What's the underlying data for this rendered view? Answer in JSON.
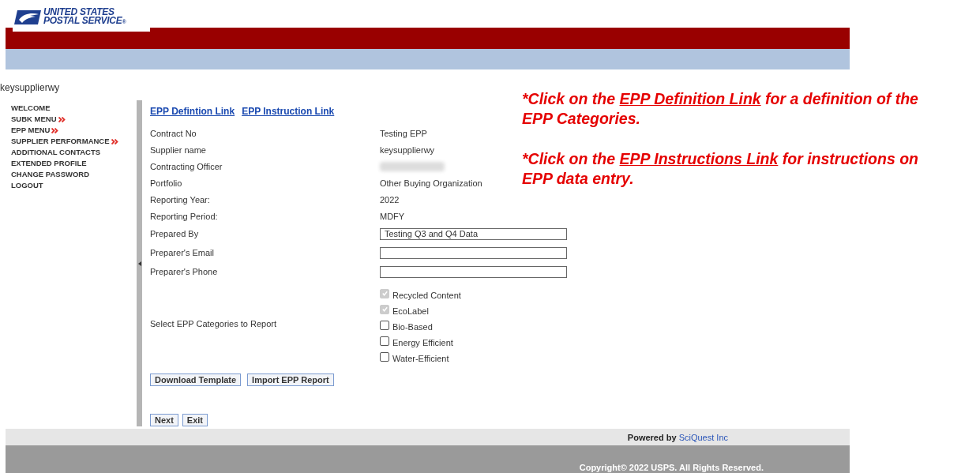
{
  "logo": {
    "line1": "UNITED STATES",
    "line2": "POSTAL SERVICE",
    "mark": "®"
  },
  "user": "keysupplierwy",
  "nav": [
    {
      "label": "WELCOME",
      "submenu": false
    },
    {
      "label": "SUBK MENU",
      "submenu": true
    },
    {
      "label": "EPP MENU",
      "submenu": true
    },
    {
      "label": "SUPPLIER PERFORMANCE",
      "submenu": true
    },
    {
      "label": "ADDITIONAL CONTACTS",
      "submenu": false
    },
    {
      "label": "EXTENDED PROFILE",
      "submenu": false
    },
    {
      "label": "CHANGE PASSWORD",
      "submenu": false
    },
    {
      "label": "LOGOUT",
      "submenu": false
    }
  ],
  "links": [
    "EPP Defintion Link",
    "EPP Instruction Link"
  ],
  "fields": [
    {
      "kind": "text",
      "label": "Contract No",
      "value": "Testing EPP"
    },
    {
      "kind": "text",
      "label": "Supplier name",
      "value": "keysupplierwy"
    },
    {
      "kind": "redacted",
      "label": "Contracting Officer"
    },
    {
      "kind": "text",
      "label": "Portfolio",
      "value": "Other Buying Organization"
    },
    {
      "kind": "text",
      "label": "Reporting Year:",
      "value": "2022"
    },
    {
      "kind": "text",
      "label": "Reporting Period:",
      "value": "MDFY"
    },
    {
      "kind": "input",
      "label": "Prepared By",
      "value": "Testing Q3 and Q4 Data"
    },
    {
      "kind": "input",
      "label": "Preparer's Email"
    },
    {
      "kind": "input",
      "label": "Preparer's Phone"
    }
  ],
  "categories": {
    "label": "Select EPP Categories to Report",
    "options": [
      {
        "label": "Recycled Content",
        "checked": true,
        "disabled": true
      },
      {
        "label": "EcoLabel",
        "checked": true,
        "disabled": true
      },
      {
        "label": "Bio-Based",
        "checked": false,
        "disabled": false
      },
      {
        "label": "Energy Efficient",
        "checked": false,
        "disabled": false
      },
      {
        "label": "Water-Efficient",
        "checked": false,
        "disabled": false
      }
    ]
  },
  "action_buttons": [
    "Download Template",
    "Import EPP Report"
  ],
  "nav_buttons": [
    "Next",
    "Exit"
  ],
  "notes": [
    {
      "before": "*Click on the ",
      "link": "EPP Definition Link",
      "after": " for a definition of the EPP Categories."
    },
    {
      "before": "*Click on the ",
      "link": "EPP Instructions Link",
      "after": " for instructions on EPP data entry."
    }
  ],
  "footer": {
    "powered_prefix": "Powered by",
    "powered_link": "SciQuest Inc",
    "copyright": "Copyright© 2022 USPS. All Rights Reserved."
  }
}
